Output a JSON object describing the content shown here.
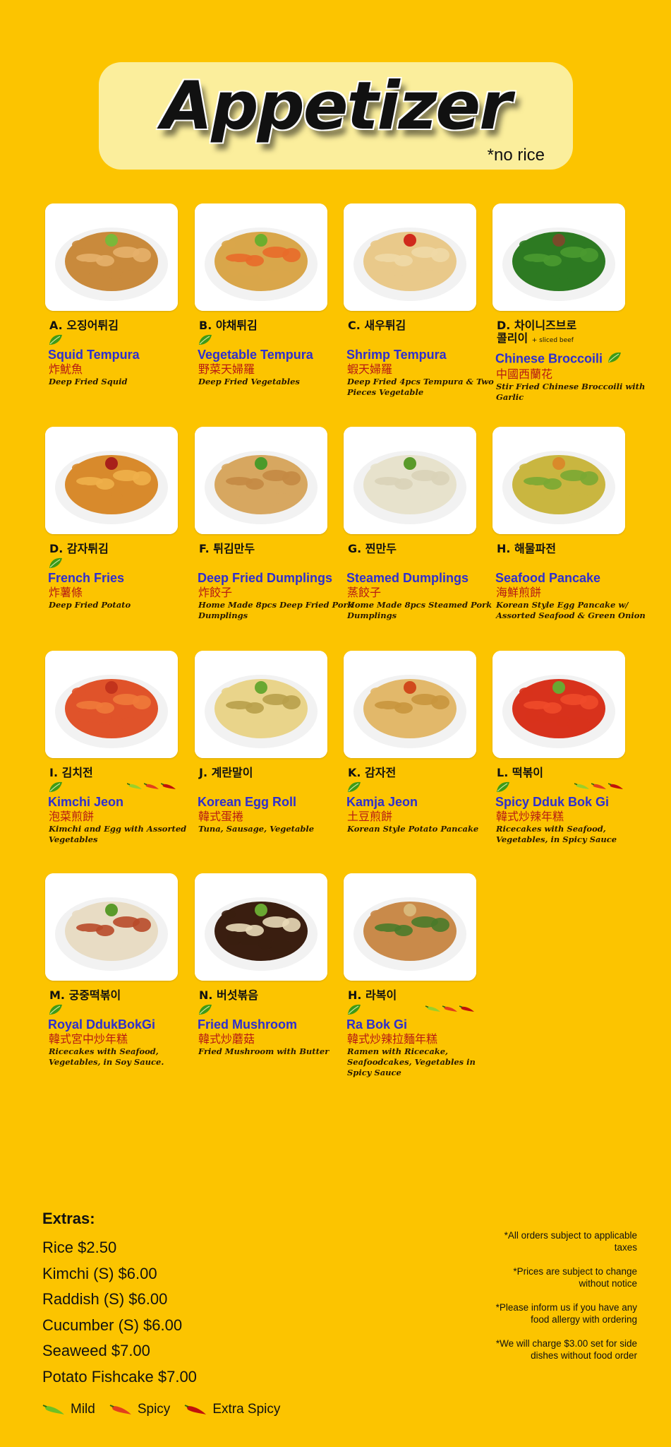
{
  "header": {
    "title": "Appetizer",
    "note": "*no rice"
  },
  "items": [
    {
      "code": "A. 오징어튀김",
      "korean_sub": "",
      "english": "Squid Tempura",
      "chinese": "炸魷魚",
      "description": "Deep Fried Squid",
      "mild": true,
      "spicy_level": 0
    },
    {
      "code": "B. 야채튀김",
      "korean_sub": "",
      "english": "Vegetable Tempura",
      "chinese": "野菜天婦羅",
      "description": "Deep Fried Vegetables",
      "mild": true,
      "spicy_level": 0
    },
    {
      "code": "C. 새우튀김",
      "korean_sub": "",
      "english": "Shrimp Tempura",
      "chinese": "蝦天婦羅",
      "description": "Deep Fried 4pcs Tempura & Two Pieces Vegetable",
      "mild": false,
      "spicy_level": 0
    },
    {
      "code": "D. 차이니즈브로",
      "code2": "콜리이",
      "korean_sub": "+ sliced beef",
      "english": "Chinese Broccoili",
      "chinese": "中國西蘭花",
      "description": "Stir Fried Chinese Broccoili with Garlic",
      "mild": true,
      "spicy_level": 0
    },
    {
      "code": "D. 감자튀김",
      "korean_sub": "",
      "english": "French Fries",
      "chinese": "炸薯條",
      "description": "Deep Fried Potato",
      "mild": true,
      "spicy_level": 0
    },
    {
      "code": "F. 튀김만두",
      "korean_sub": "",
      "english": "Deep Fried Dumplings",
      "chinese": "炸餃子",
      "description": "Home Made 8pcs Deep Fried Pork Dumplings",
      "mild": false,
      "spicy_level": 0
    },
    {
      "code": "G. 찐만두",
      "korean_sub": "",
      "english": "Steamed Dumplings",
      "chinese": "蒸餃子",
      "description": "Home Made 8pcs Steamed Pork Dumplings",
      "mild": false,
      "spicy_level": 0
    },
    {
      "code": "H. 해물파전",
      "korean_sub": "",
      "english": "Seafood Pancake",
      "chinese": "海鮮煎餅",
      "description": "Korean Style Egg Pancake w/ Assorted Seafood & Green Onion",
      "mild": false,
      "spicy_level": 0
    },
    {
      "code": "I. 김치전",
      "korean_sub": "",
      "english": "Kimchi Jeon",
      "chinese": "泡菜煎餅",
      "description": "Kimchi and Egg with Assorted Vegetables",
      "mild": true,
      "spicy_level": 3
    },
    {
      "code": "J. 계란말이",
      "korean_sub": "",
      "english": "Korean Egg Roll",
      "chinese": "韓式蛋捲",
      "description": "Tuna, Sausage, Vegetable",
      "mild": false,
      "spicy_level": 0
    },
    {
      "code": "K. 감자전",
      "korean_sub": "",
      "english": "Kamja Jeon",
      "chinese": "土豆煎餅",
      "description": "Korean Style Potato Pancake",
      "mild": true,
      "spicy_level": 0
    },
    {
      "code": "L. 떡볶이",
      "korean_sub": "",
      "english": "Spicy Dduk Bok Gi",
      "chinese": "韓式炒辣年糕",
      "description": "Ricecakes with Seafood, Vegetables, in Spicy Sauce",
      "mild": true,
      "spicy_level": 3
    },
    {
      "code": "M. 궁중떡볶이",
      "korean_sub": "",
      "english": "Royal DdukBokGi",
      "chinese": "韓式宮中炒年糕",
      "description": "Ricecakes with Seafood, Vegetables, in Soy Sauce.",
      "mild": true,
      "spicy_level": 0
    },
    {
      "code": "N. 버섯볶음",
      "korean_sub": "",
      "english": "Fried Mushroom",
      "chinese": "韓式炒蘑菇",
      "description": "Fried Mushroom with Butter",
      "mild": true,
      "spicy_level": 0
    },
    {
      "code": "H. 라복이",
      "korean_sub": "",
      "english": "Ra Bok Gi",
      "chinese": "韓式炒辣拉麵年糕",
      "description": "Ramen with Ricecake, Seafoodcakes, Vegetables in Spicy Sauce",
      "mild": true,
      "spicy_level": 3
    }
  ],
  "extras": {
    "title": "Extras:",
    "lines": [
      "Rice $2.50",
      "Kimchi (S) $6.00",
      "Raddish (S) $6.00",
      "Cucumber (S) $6.00",
      "Seaweed $7.00",
      "Potato Fishcake $7.00"
    ]
  },
  "legend": {
    "mild": "Mild",
    "spicy": "Spicy",
    "extra_spicy": "Extra Spicy"
  },
  "notes": [
    "*All orders subject to applicable taxes",
    "*Prices are subject to change without notice",
    "*Please inform us if you have any food allergy with ordering",
    "*We will charge $3.00 set for side dishes without food order"
  ],
  "colors": {
    "background": "#fcc400",
    "title_box": "#fbee9c",
    "english_name": "#2e2fd0",
    "chinese_name": "#b61a14",
    "mild": "#3e9a17",
    "spicy": "#d5241a"
  }
}
